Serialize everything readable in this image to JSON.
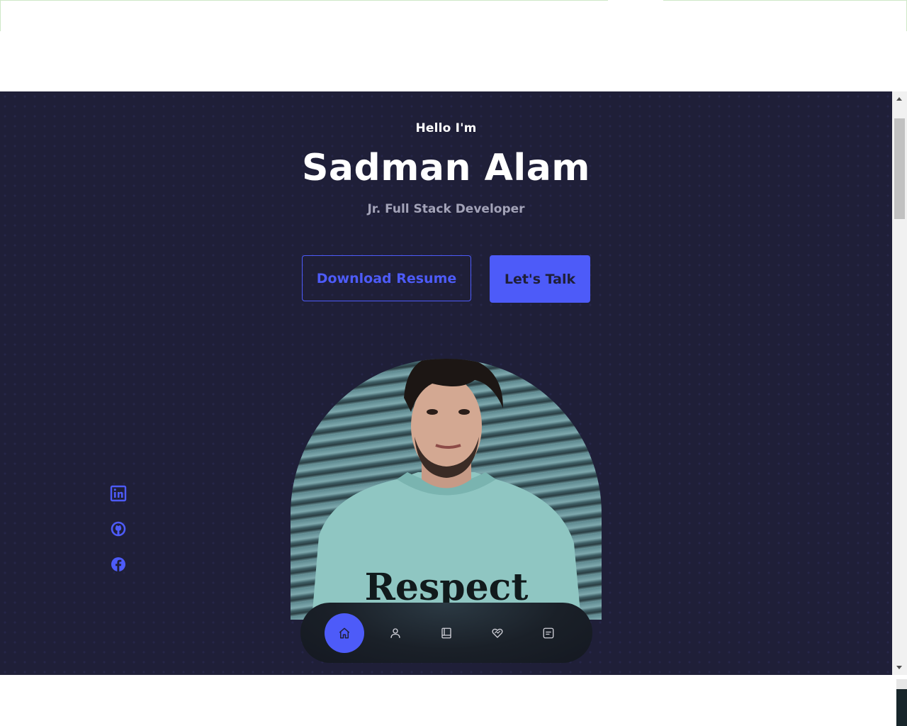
{
  "hero": {
    "greeting": "Hello I'm",
    "name": "Sadman Alam",
    "role": "Jr. Full Stack Developer",
    "download_label": "Download Resume",
    "talk_label": "Let's Talk"
  },
  "portrait": {
    "alt": "Sadman Alam",
    "shirt_text": "Respect"
  },
  "socials": [
    {
      "icon": "linkedin-icon"
    },
    {
      "icon": "github-icon"
    },
    {
      "icon": "facebook-icon"
    }
  ],
  "nav": [
    {
      "icon": "home-icon",
      "active": true
    },
    {
      "icon": "user-icon",
      "active": false
    },
    {
      "icon": "book-icon",
      "active": false
    },
    {
      "icon": "services-icon",
      "active": false
    },
    {
      "icon": "message-icon",
      "active": false
    }
  ],
  "colors": {
    "background": "#1f1f38",
    "accent": "#4d5bf9",
    "text_light": "#ffffff",
    "text_muted": "#a3a3b8"
  }
}
